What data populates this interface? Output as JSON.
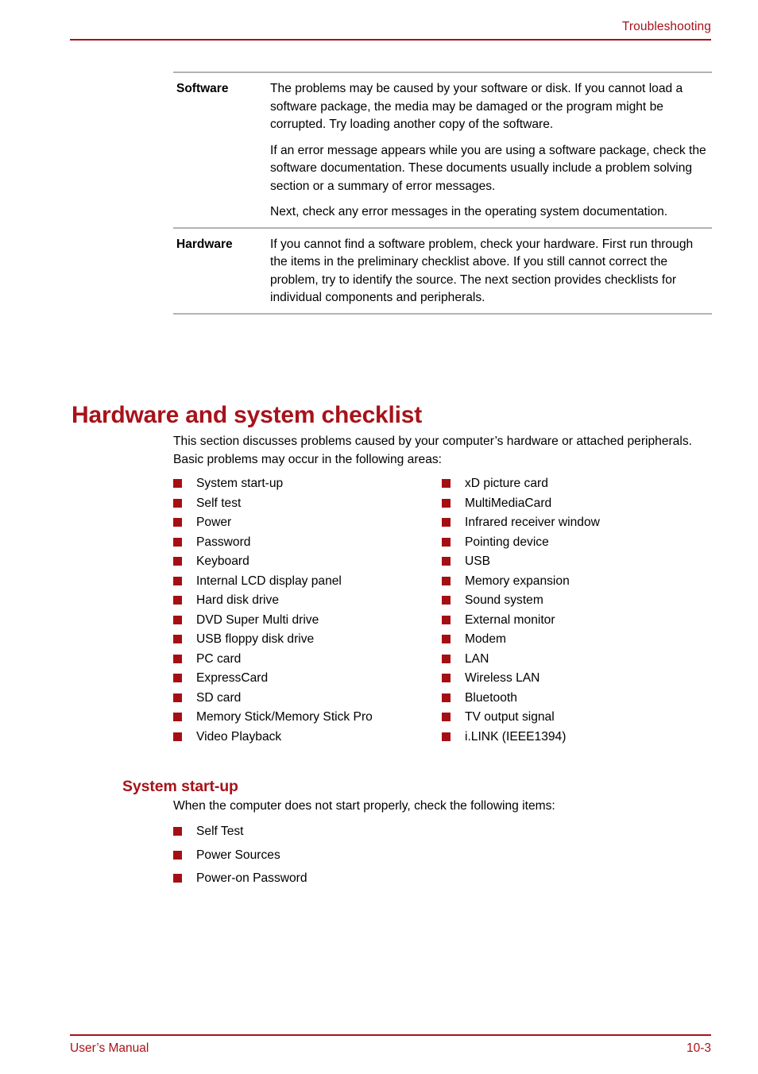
{
  "header": {
    "title": "Troubleshooting",
    "rule_color": "#A8121A"
  },
  "definition_table": {
    "rows": [
      {
        "term": "Software",
        "paragraphs": [
          "The problems may be caused by your software or disk. If you cannot load a software package, the media may be damaged or the program might be corrupted. Try loading another copy of the software.",
          "If an error message appears while you are using a software package, check the software documentation. These documents usually include a problem solving section or a summary of error messages.",
          "Next, check any error messages in the operating system documentation."
        ]
      },
      {
        "term": "Hardware",
        "paragraphs": [
          "If you cannot find a software problem, check your hardware. First run through the items in the preliminary checklist above. If you still cannot correct the problem, try to identify the source. The next section provides checklists for individual components and peripherals."
        ]
      }
    ]
  },
  "section": {
    "heading": "Hardware and system checklist",
    "intro": "This section discusses problems caused by your computer’s hardware or attached peripherals. Basic problems may occur in the following areas:",
    "checklist_left": [
      "System start-up",
      "Self test",
      "Power",
      "Password",
      "Keyboard",
      "Internal LCD display panel",
      "Hard disk drive",
      "DVD Super Multi drive",
      "USB floppy disk drive",
      "PC card",
      "ExpressCard",
      "SD card",
      "Memory Stick/Memory Stick Pro",
      "Video Playback"
    ],
    "checklist_right": [
      "xD picture card",
      "MultiMediaCard",
      "Infrared receiver window",
      "Pointing device",
      "USB",
      "Memory expansion",
      "Sound system",
      "External monitor",
      "Modem",
      "LAN",
      "Wireless LAN",
      "Bluetooth",
      "TV output signal",
      "i.LINK (IEEE1394)"
    ]
  },
  "subsection": {
    "heading": "System start-up",
    "intro": "When the computer does not start properly, check the following items:",
    "items": [
      "Self Test",
      "Power Sources",
      "Power-on Password"
    ]
  },
  "footer": {
    "left": "User’s Manual",
    "right": "10-3",
    "rule_color": "#A8121A"
  },
  "colors": {
    "accent_red": "#A8121A",
    "bullet_red": "#A50F13",
    "table_rule_gray": "#B3B3B3",
    "text_black": "#000000"
  }
}
